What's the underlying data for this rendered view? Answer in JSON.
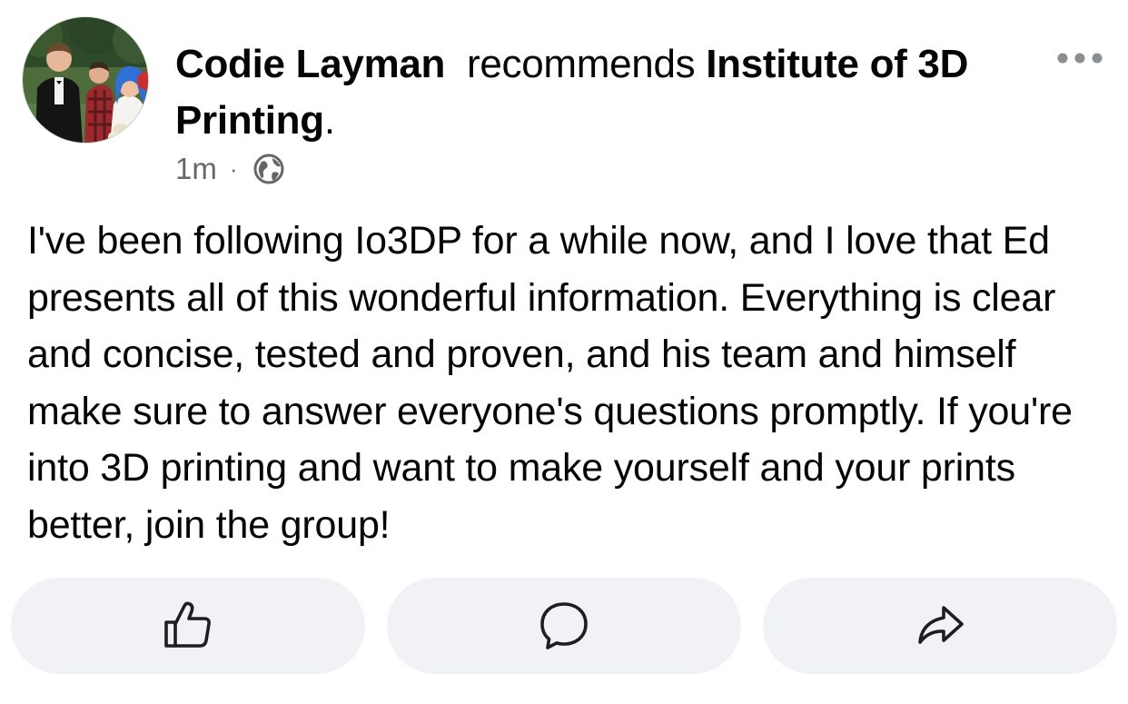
{
  "post": {
    "author": "Codie Layman",
    "action": "recommends",
    "target_line1": "Institute of 3D",
    "target_line2": "Printing",
    "period": ".",
    "time": "1m",
    "separator": "·",
    "privacy_icon": "globe-icon",
    "more_icon": "more-options-icon",
    "body": "I've been following Io3DP for a while now, and I love that Ed presents all of this wonderful information. Everything is clear and concise, tested and proven, and his team and himself make sure to answer everyone's questions promptly. If you're into 3D printing and want to make yourself and your prints better, join the group!"
  },
  "actions": [
    {
      "icon": "thumbs-up-icon"
    },
    {
      "icon": "comment-icon"
    },
    {
      "icon": "share-icon"
    }
  ],
  "colors": {
    "text_primary": "#050505",
    "text_secondary": "#65676b",
    "button_bg": "#f0f2f5"
  }
}
